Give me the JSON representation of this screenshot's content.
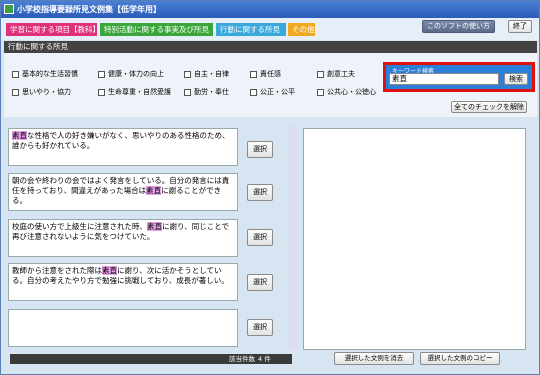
{
  "window": {
    "title": "小学校指導要録所見文例集【低学年用】"
  },
  "tabs": [
    "学習に関する項目【教科】",
    "特別活動に関する事実及び所見",
    "行動に関する所見",
    "その他"
  ],
  "toolbar": {
    "howto_label": "このソフトの使い方",
    "close_label": "終了"
  },
  "section": {
    "title": "行動に関する所見"
  },
  "checkboxes": [
    "基本的な生活習慣",
    "健康・体力の向上",
    "自主・自律",
    "責任感",
    "創意工夫",
    "思いやり・協力",
    "生命尊重・自然愛護",
    "勤労・奉仕",
    "公正・公平",
    "公共心・公徳心"
  ],
  "keyword": {
    "label": "キーワード検索",
    "value": "素直",
    "search_label": "検索"
  },
  "clear_checks_label": "全てのチェックを解除",
  "items": [
    {
      "pre": "",
      "hl": "素直",
      "post": "な性格で人の好き嫌いがなく、思いやりのある性格のため、誰からも好かれている。"
    },
    {
      "pre": "朝の会や終わりの会ではよく発言をしている。自分の発言には責任を持っており、間違えがあった場合は",
      "hl": "素直",
      "post": "に謝ることができる。"
    },
    {
      "pre": "校庭の使い方で上級生に注意された時、",
      "hl": "素直",
      "post": "に謝り、同じことで再び注意されないように気をつけていた。"
    },
    {
      "pre": "教師から注意をされた際は",
      "hl": "素直",
      "post": "に謝り、次に活かそうとしている。自分の考えたやり方で勉強に挑戦しており、成長が著しい。"
    },
    {
      "pre": "",
      "hl": "",
      "post": ""
    }
  ],
  "select_label": "選択",
  "status": {
    "count_label": "該当件数",
    "count_value": "4 件"
  },
  "bottom": {
    "clear_selected_label": "選択した文例を消去",
    "copy_selected_label": "選択した文例のコピー"
  }
}
